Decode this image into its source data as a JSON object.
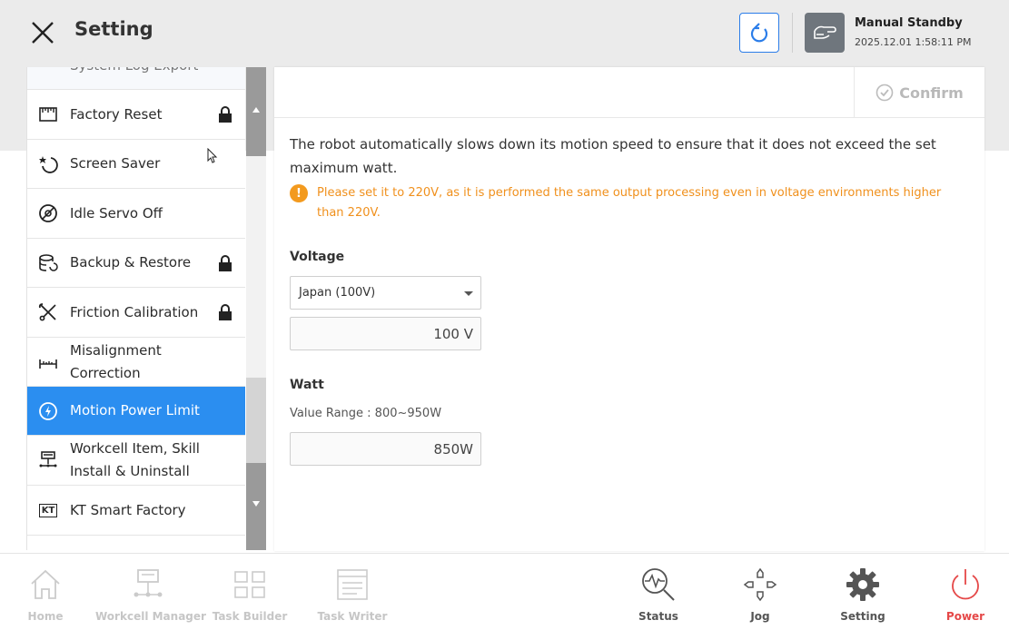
{
  "header": {
    "title": "Setting",
    "mode": "Manual Standby",
    "datetime": "2025.12.01 1:58:11 PM",
    "close_icon": "close-icon",
    "refresh_icon": "refresh-icon"
  },
  "sidebar": {
    "items": [
      {
        "label": "System Log Export",
        "icon": "export-icon",
        "locked": false
      },
      {
        "label": "Factory Reset",
        "icon": "factory-icon",
        "locked": true
      },
      {
        "label": "Screen Saver",
        "icon": "screensaver-icon",
        "locked": false
      },
      {
        "label": "Idle Servo Off",
        "icon": "servo-icon",
        "locked": false
      },
      {
        "label": "Backup & Restore",
        "icon": "backup-icon",
        "locked": true
      },
      {
        "label": "Friction Calibration",
        "icon": "calibration-icon",
        "locked": true
      },
      {
        "label": "Misalignment Correction",
        "label_line1": "Misalignment",
        "label_line2": "Correction",
        "icon": "ruler-icon",
        "locked": false
      },
      {
        "label": "Motion Power Limit",
        "icon": "power-limit-icon",
        "locked": false,
        "active": true
      },
      {
        "label": "Workcell Item, Skill Install & Uninstall",
        "label_line1": "Workcell Item, Skill",
        "label_line2": "Install & Uninstall",
        "icon": "workcell-item-icon",
        "locked": false
      },
      {
        "label": "KT Smart Factory",
        "icon": "kt-icon",
        "icon_text": "KT",
        "locked": false
      }
    ]
  },
  "main": {
    "confirm_label": "Confirm",
    "description": "The robot automatically slows down its motion speed to ensure that it does not exceed the set maximum watt.",
    "warning_mark": "!",
    "warning": "Please set it to 220V, as it is performed the same output processing even in voltage environments higher than 220V.",
    "voltage_label": "Voltage",
    "voltage_select": "Japan (100V)",
    "voltage_value": "100 V",
    "watt_label": "Watt",
    "watt_range": "Value Range : 800~950W",
    "watt_value": "850W"
  },
  "bottom_nav": [
    {
      "label": "Home",
      "icon": "home-icon",
      "enabled": false
    },
    {
      "label": "Workcell Manager",
      "icon": "workcell-manager-icon",
      "enabled": false
    },
    {
      "label": "Task Builder",
      "icon": "task-builder-icon",
      "enabled": false
    },
    {
      "label": "Task Writer",
      "icon": "task-writer-icon",
      "enabled": false
    },
    {
      "label": "Status",
      "icon": "status-icon",
      "enabled": true
    },
    {
      "label": "Jog",
      "icon": "jog-icon",
      "enabled": true
    },
    {
      "label": "Setting",
      "icon": "gear-icon",
      "enabled": true,
      "active": true
    },
    {
      "label": "Power",
      "icon": "power-icon",
      "enabled": true
    }
  ],
  "colors": {
    "accent": "#2b8ef0",
    "warning": "#f39a1e",
    "power": "#e54848"
  }
}
